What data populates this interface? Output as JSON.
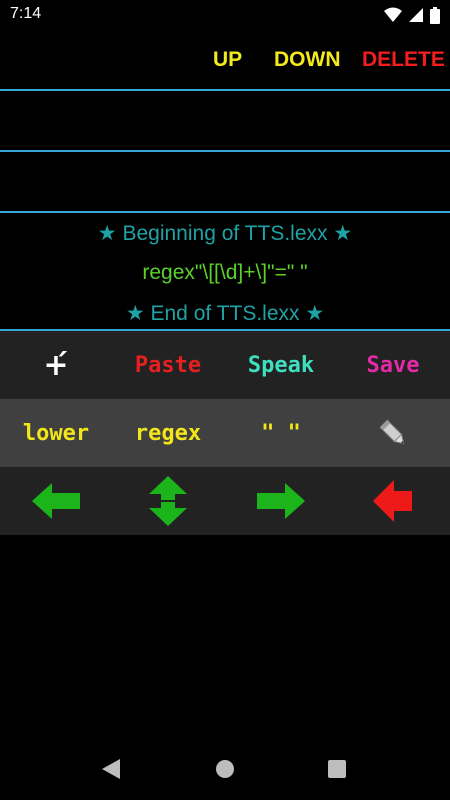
{
  "status_bar": {
    "time": "7:14",
    "icons": [
      "wifi-icon",
      "cell-signal-icon",
      "battery-icon"
    ]
  },
  "toolbar": {
    "up_label": "UP",
    "down_label": "DOWN",
    "delete_label": "DELETE",
    "colors": {
      "up": "#f4ea1a",
      "down": "#f4ea1a",
      "delete": "#f01e1e"
    }
  },
  "content": {
    "beginning_marker": "★ Beginning of TTS.lexx ★",
    "regex_line": "regex\"\\[[\\d]+\\]\"=\" \"",
    "end_marker": "★ End of TTS.lexx ★",
    "colors": {
      "marker": "#1fa2a6",
      "regex": "#5bd12a",
      "divider": "#35a6d8"
    }
  },
  "keyboard": {
    "row1": {
      "add_symbol": "+́",
      "paste": "Paste",
      "speak": "Speak",
      "save": "Save",
      "colors": {
        "paste": "#e62020",
        "speak": "#3ee0c0",
        "save": "#e629a8",
        "background": "#222222"
      }
    },
    "row2": {
      "lower": "lower",
      "regex": "regex",
      "quotes": "\" \"",
      "edit_icon": "pencil-icon",
      "colors": {
        "text": "#f2e61a",
        "background": "#404040"
      }
    },
    "row3": {
      "icons": [
        "arrow-left-icon",
        "arrow-up-down-icon",
        "arrow-right-icon",
        "backspace-arrow-icon"
      ],
      "colors": {
        "arrows": "#1bb51b",
        "backspace": "#ee1a1a",
        "background": "#222222"
      }
    }
  },
  "nav_bar": {
    "icons": [
      "back-icon",
      "home-icon",
      "recents-icon"
    ]
  }
}
